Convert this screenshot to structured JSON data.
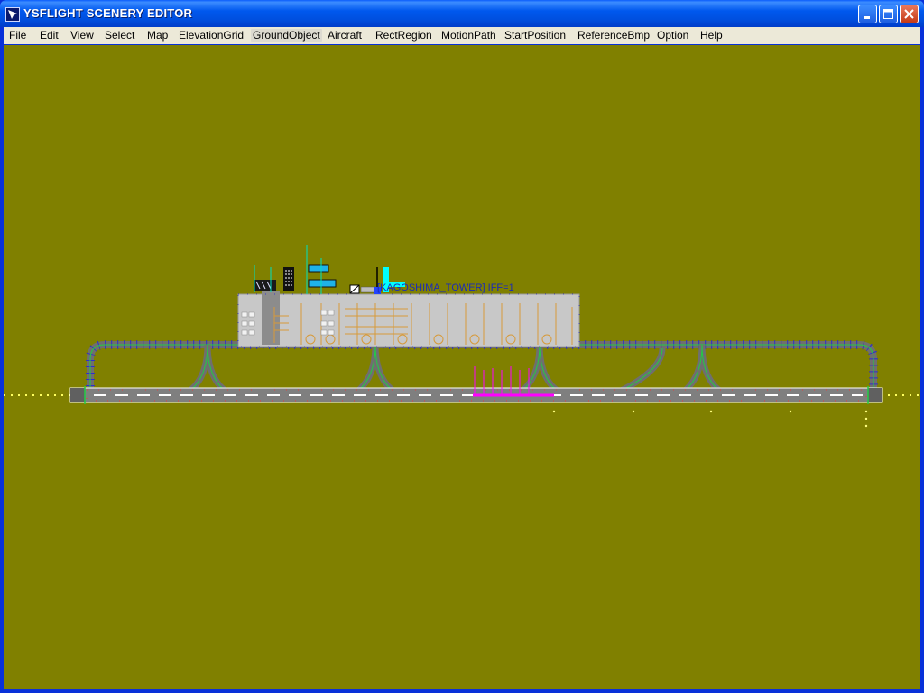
{
  "window": {
    "title": "YSFLIGHT SCENERY EDITOR",
    "minimize_icon": "minimize-icon",
    "maximize_icon": "maximize-icon",
    "close_icon": "close-icon"
  },
  "menu": {
    "items": [
      {
        "label": "File"
      },
      {
        "label": "Edit"
      },
      {
        "label": "View"
      },
      {
        "label": "Select"
      },
      {
        "label": "Map"
      },
      {
        "label": "ElevationGrid"
      },
      {
        "label": "GroundObject"
      },
      {
        "label": "Aircraft"
      },
      {
        "label": "RectRegion"
      },
      {
        "label": "MotionPath"
      },
      {
        "label": "StartPosition"
      },
      {
        "label": "ReferenceBmp"
      },
      {
        "label": "Option"
      },
      {
        "label": "Help"
      }
    ]
  },
  "canvas": {
    "background_color": "#808000",
    "selected_object_label": "[KAGOSHIMA_TOWER] IFF=1"
  },
  "colors": {
    "titlebar": "#0058ee",
    "menubar": "#ece9d8",
    "terrain": "#808000",
    "runway": "#7f7f7f",
    "apron": "#c8c8c8",
    "taxi_edge_light": "#2a2ad0",
    "taxi_centerline": "#22cc44",
    "gate_line": "#d79a3a",
    "selection": "#00ffff",
    "approach_marker": "#ff00ff"
  }
}
